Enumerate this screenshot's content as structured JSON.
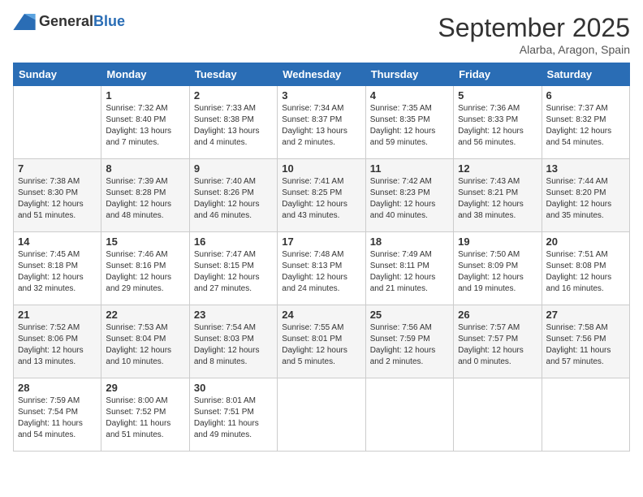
{
  "header": {
    "logo_general": "General",
    "logo_blue": "Blue",
    "month_title": "September 2025",
    "location": "Alarba, Aragon, Spain"
  },
  "days_of_week": [
    "Sunday",
    "Monday",
    "Tuesday",
    "Wednesday",
    "Thursday",
    "Friday",
    "Saturday"
  ],
  "weeks": [
    [
      {
        "day": "",
        "sunrise": "",
        "sunset": "",
        "daylight": ""
      },
      {
        "day": "1",
        "sunrise": "Sunrise: 7:32 AM",
        "sunset": "Sunset: 8:40 PM",
        "daylight": "Daylight: 13 hours and 7 minutes."
      },
      {
        "day": "2",
        "sunrise": "Sunrise: 7:33 AM",
        "sunset": "Sunset: 8:38 PM",
        "daylight": "Daylight: 13 hours and 4 minutes."
      },
      {
        "day": "3",
        "sunrise": "Sunrise: 7:34 AM",
        "sunset": "Sunset: 8:37 PM",
        "daylight": "Daylight: 13 hours and 2 minutes."
      },
      {
        "day": "4",
        "sunrise": "Sunrise: 7:35 AM",
        "sunset": "Sunset: 8:35 PM",
        "daylight": "Daylight: 12 hours and 59 minutes."
      },
      {
        "day": "5",
        "sunrise": "Sunrise: 7:36 AM",
        "sunset": "Sunset: 8:33 PM",
        "daylight": "Daylight: 12 hours and 56 minutes."
      },
      {
        "day": "6",
        "sunrise": "Sunrise: 7:37 AM",
        "sunset": "Sunset: 8:32 PM",
        "daylight": "Daylight: 12 hours and 54 minutes."
      }
    ],
    [
      {
        "day": "7",
        "sunrise": "Sunrise: 7:38 AM",
        "sunset": "Sunset: 8:30 PM",
        "daylight": "Daylight: 12 hours and 51 minutes."
      },
      {
        "day": "8",
        "sunrise": "Sunrise: 7:39 AM",
        "sunset": "Sunset: 8:28 PM",
        "daylight": "Daylight: 12 hours and 48 minutes."
      },
      {
        "day": "9",
        "sunrise": "Sunrise: 7:40 AM",
        "sunset": "Sunset: 8:26 PM",
        "daylight": "Daylight: 12 hours and 46 minutes."
      },
      {
        "day": "10",
        "sunrise": "Sunrise: 7:41 AM",
        "sunset": "Sunset: 8:25 PM",
        "daylight": "Daylight: 12 hours and 43 minutes."
      },
      {
        "day": "11",
        "sunrise": "Sunrise: 7:42 AM",
        "sunset": "Sunset: 8:23 PM",
        "daylight": "Daylight: 12 hours and 40 minutes."
      },
      {
        "day": "12",
        "sunrise": "Sunrise: 7:43 AM",
        "sunset": "Sunset: 8:21 PM",
        "daylight": "Daylight: 12 hours and 38 minutes."
      },
      {
        "day": "13",
        "sunrise": "Sunrise: 7:44 AM",
        "sunset": "Sunset: 8:20 PM",
        "daylight": "Daylight: 12 hours and 35 minutes."
      }
    ],
    [
      {
        "day": "14",
        "sunrise": "Sunrise: 7:45 AM",
        "sunset": "Sunset: 8:18 PM",
        "daylight": "Daylight: 12 hours and 32 minutes."
      },
      {
        "day": "15",
        "sunrise": "Sunrise: 7:46 AM",
        "sunset": "Sunset: 8:16 PM",
        "daylight": "Daylight: 12 hours and 29 minutes."
      },
      {
        "day": "16",
        "sunrise": "Sunrise: 7:47 AM",
        "sunset": "Sunset: 8:15 PM",
        "daylight": "Daylight: 12 hours and 27 minutes."
      },
      {
        "day": "17",
        "sunrise": "Sunrise: 7:48 AM",
        "sunset": "Sunset: 8:13 PM",
        "daylight": "Daylight: 12 hours and 24 minutes."
      },
      {
        "day": "18",
        "sunrise": "Sunrise: 7:49 AM",
        "sunset": "Sunset: 8:11 PM",
        "daylight": "Daylight: 12 hours and 21 minutes."
      },
      {
        "day": "19",
        "sunrise": "Sunrise: 7:50 AM",
        "sunset": "Sunset: 8:09 PM",
        "daylight": "Daylight: 12 hours and 19 minutes."
      },
      {
        "day": "20",
        "sunrise": "Sunrise: 7:51 AM",
        "sunset": "Sunset: 8:08 PM",
        "daylight": "Daylight: 12 hours and 16 minutes."
      }
    ],
    [
      {
        "day": "21",
        "sunrise": "Sunrise: 7:52 AM",
        "sunset": "Sunset: 8:06 PM",
        "daylight": "Daylight: 12 hours and 13 minutes."
      },
      {
        "day": "22",
        "sunrise": "Sunrise: 7:53 AM",
        "sunset": "Sunset: 8:04 PM",
        "daylight": "Daylight: 12 hours and 10 minutes."
      },
      {
        "day": "23",
        "sunrise": "Sunrise: 7:54 AM",
        "sunset": "Sunset: 8:03 PM",
        "daylight": "Daylight: 12 hours and 8 minutes."
      },
      {
        "day": "24",
        "sunrise": "Sunrise: 7:55 AM",
        "sunset": "Sunset: 8:01 PM",
        "daylight": "Daylight: 12 hours and 5 minutes."
      },
      {
        "day": "25",
        "sunrise": "Sunrise: 7:56 AM",
        "sunset": "Sunset: 7:59 PM",
        "daylight": "Daylight: 12 hours and 2 minutes."
      },
      {
        "day": "26",
        "sunrise": "Sunrise: 7:57 AM",
        "sunset": "Sunset: 7:57 PM",
        "daylight": "Daylight: 12 hours and 0 minutes."
      },
      {
        "day": "27",
        "sunrise": "Sunrise: 7:58 AM",
        "sunset": "Sunset: 7:56 PM",
        "daylight": "Daylight: 11 hours and 57 minutes."
      }
    ],
    [
      {
        "day": "28",
        "sunrise": "Sunrise: 7:59 AM",
        "sunset": "Sunset: 7:54 PM",
        "daylight": "Daylight: 11 hours and 54 minutes."
      },
      {
        "day": "29",
        "sunrise": "Sunrise: 8:00 AM",
        "sunset": "Sunset: 7:52 PM",
        "daylight": "Daylight: 11 hours and 51 minutes."
      },
      {
        "day": "30",
        "sunrise": "Sunrise: 8:01 AM",
        "sunset": "Sunset: 7:51 PM",
        "daylight": "Daylight: 11 hours and 49 minutes."
      },
      {
        "day": "",
        "sunrise": "",
        "sunset": "",
        "daylight": ""
      },
      {
        "day": "",
        "sunrise": "",
        "sunset": "",
        "daylight": ""
      },
      {
        "day": "",
        "sunrise": "",
        "sunset": "",
        "daylight": ""
      },
      {
        "day": "",
        "sunrise": "",
        "sunset": "",
        "daylight": ""
      }
    ]
  ]
}
